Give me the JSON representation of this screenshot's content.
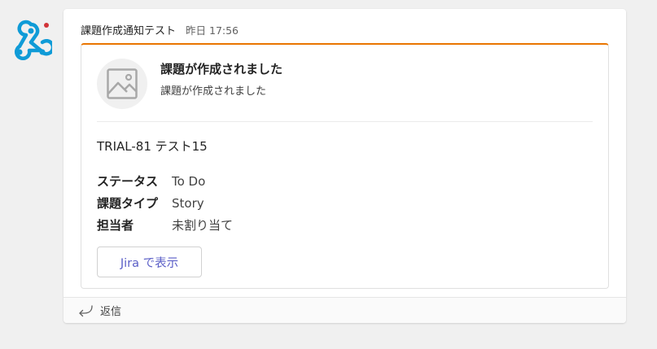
{
  "avatar": {
    "icon": "webhook-icon",
    "color": "#0f9bd7"
  },
  "message": {
    "sender": "課題作成通知テスト",
    "timestamp": "昨日 17:56"
  },
  "card": {
    "accent_color": "#e97500",
    "thumbnail_icon": "image-placeholder-icon",
    "title": "課題が作成されました",
    "subtitle": "課題が作成されました",
    "issue_heading": "TRIAL-81 テスト15",
    "facts": [
      {
        "key": "ステータス",
        "value": "To Do"
      },
      {
        "key": "課題タイプ",
        "value": "Story"
      },
      {
        "key": "担当者",
        "value": "未割り当て"
      }
    ],
    "action_label": "Jira で表示",
    "action_color": "#5b5fc7"
  },
  "reply": {
    "label": "返信",
    "icon": "reply-icon"
  }
}
